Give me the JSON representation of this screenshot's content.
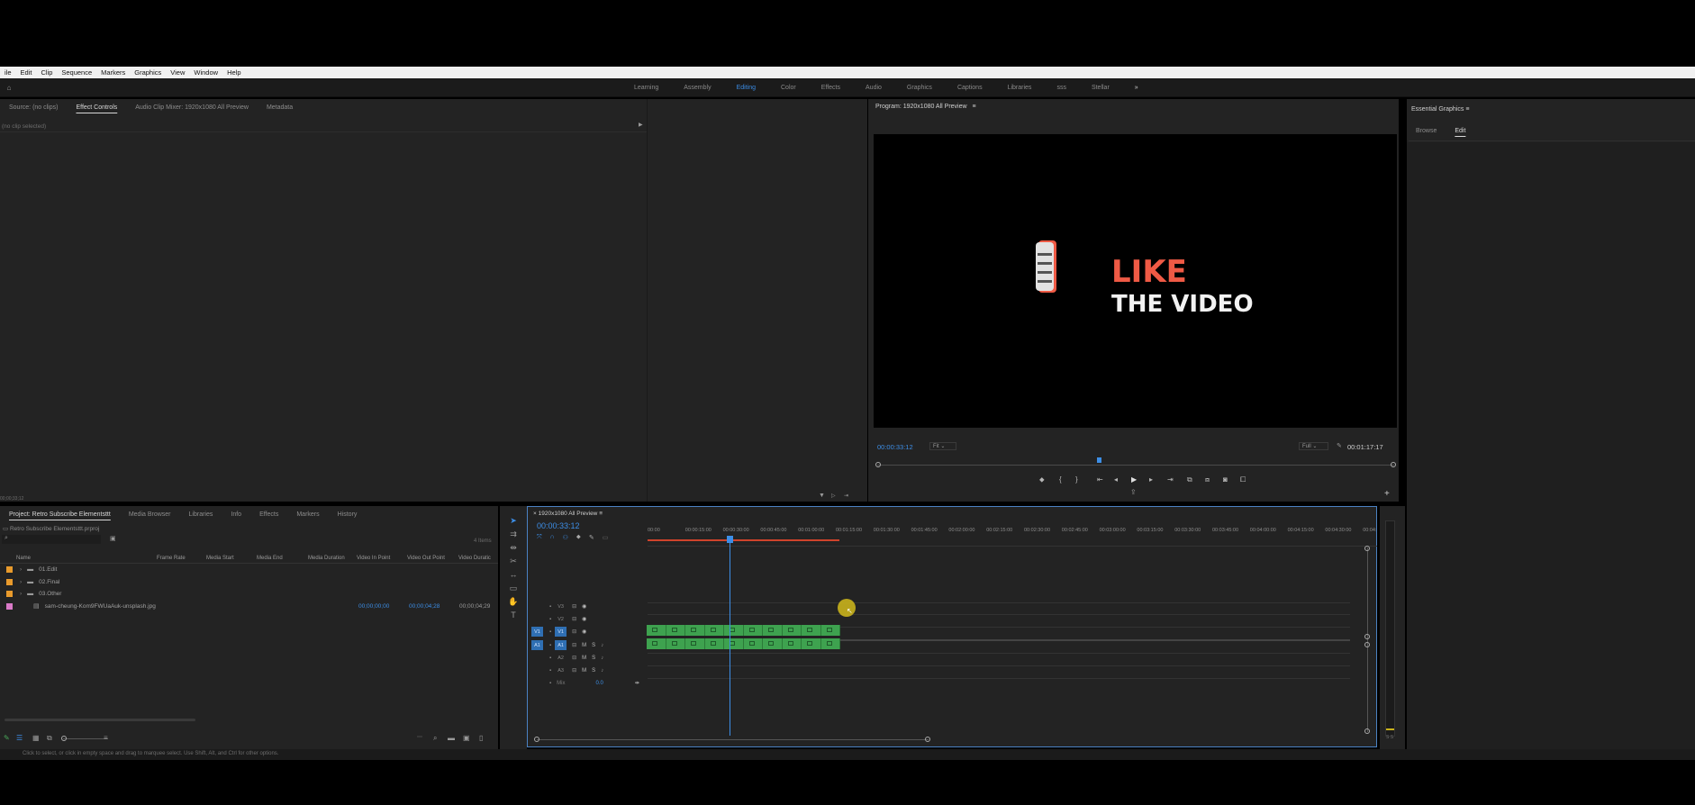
{
  "menubar": [
    "ile",
    "Edit",
    "Clip",
    "Sequence",
    "Markers",
    "Graphics",
    "View",
    "Window",
    "Help"
  ],
  "workspaces": {
    "items": [
      "Learning",
      "Assembly",
      "Editing",
      "Color",
      "Effects",
      "Audio",
      "Graphics",
      "Captions",
      "Libraries",
      "sss",
      "Stellar"
    ],
    "active": "Editing",
    "more": "»"
  },
  "source_panel": {
    "tabs": [
      "Source: (no clips)",
      "Effect Controls",
      "Audio Clip Mixer: 1920x1080 All Preview",
      "Metadata"
    ],
    "active": "Effect Controls",
    "empty_text": "(no clip selected)",
    "timecode": "00;00;33;12"
  },
  "program_monitor": {
    "title": "Program: 1920x1080 All Preview",
    "timecode": "00:00:33:12",
    "fit": "Fit",
    "resolution": "Full",
    "duration": "00:01:17:17",
    "video_text_line1": "LIKE",
    "video_text_line2": "THE VIDEO",
    "accent_color": "#ef5a45"
  },
  "essential_graphics": {
    "title": "Essential Graphics",
    "tabs": [
      "Browse",
      "Edit"
    ],
    "active": "Edit"
  },
  "project_panel": {
    "tabs": [
      "Project: Retro Subscribe Elementsttt",
      "Media Browser",
      "Libraries",
      "Info",
      "Effects",
      "Markers",
      "History"
    ],
    "active": "Project: Retro Subscribe Elementsttt",
    "path": "Retro Subscribe Elementsttt.prproj",
    "item_count": "4 Items",
    "columns": [
      "Name",
      "Frame Rate",
      "Media Start",
      "Media End",
      "Media Duration",
      "Video In Point",
      "Video Out Point",
      "Video Duratic"
    ],
    "rows": [
      {
        "name": "01.Edit",
        "type": "folder",
        "color": "#e89a2c",
        "in": "",
        "out": "",
        "dur": ""
      },
      {
        "name": "02.Final",
        "type": "folder",
        "color": "#e89a2c",
        "in": "",
        "out": "",
        "dur": ""
      },
      {
        "name": "03.Other",
        "type": "folder",
        "color": "#e89a2c",
        "in": "",
        "out": "",
        "dur": ""
      },
      {
        "name": "sam-cheung-Kom9FWUaAuk-unsplash.jpg",
        "type": "file",
        "color": "#d97ac7",
        "in": "00;00;00;00",
        "out": "00;00;04;28",
        "dur": "00;00;04;29"
      }
    ]
  },
  "timeline": {
    "title": "1920x1080 All Preview",
    "timecode": "00:00:33:12",
    "ruler": [
      "00:00",
      "00:00:15:00",
      "00:00:30:00",
      "00:00:45:00",
      "00:01:00:00",
      "00:01:15:00",
      "00:01:30:00",
      "00:01:45:00",
      "00:02:00:00",
      "00:02:15:00",
      "00:02:30:00",
      "00:02:45:00",
      "00:03:00:00",
      "00:03:15:00",
      "00:03:30:00",
      "00:03:45:00",
      "00:04:00:00",
      "00:04:15:00",
      "00:04:30:00",
      "00:04:"
    ],
    "video_tracks": [
      "V3",
      "V2",
      "V1"
    ],
    "audio_tracks": [
      "A1",
      "A2",
      "A3"
    ],
    "mix_label": "Mix",
    "mix_value": "0.0",
    "source_v": "V1",
    "source_a": "A1",
    "clip_color": "#3ea24f"
  },
  "status_bar": "Click to select, or click in empty space and drag to marquee select. Use Shift, Alt, and Ctrl for other options."
}
